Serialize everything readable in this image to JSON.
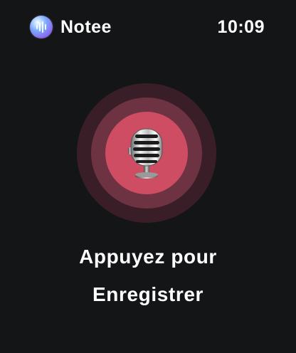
{
  "header": {
    "app_name": "Notee",
    "time": "10:09",
    "logo_icon": "notee-logo-icon"
  },
  "recorder": {
    "icon": "microphone-icon",
    "ring_colors": [
      "#3a1e27",
      "#6e3343",
      "#cf4d63"
    ]
  },
  "prompt": {
    "line1": "Appuyez pour",
    "line2": "Enregistrer"
  }
}
